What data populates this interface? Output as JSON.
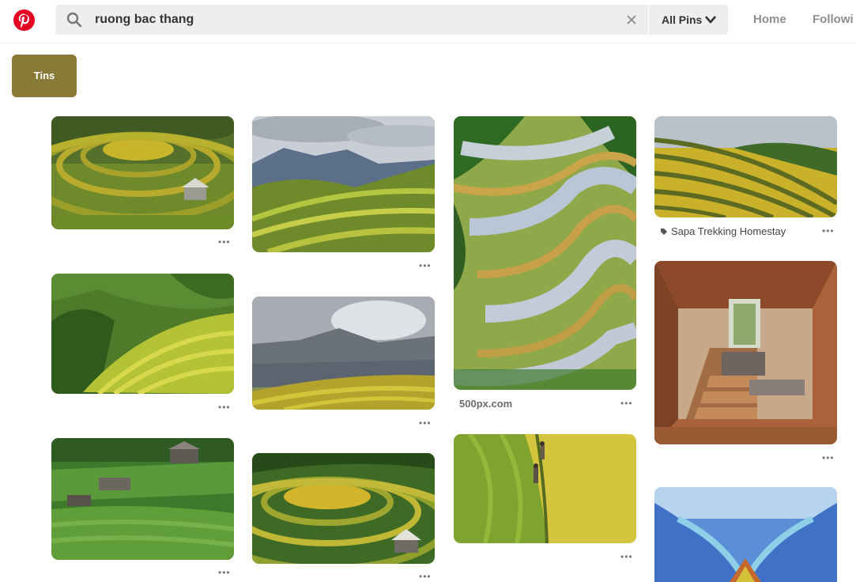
{
  "search": {
    "query": "ruong bac thang"
  },
  "filter": {
    "label": "All Pins"
  },
  "nav": {
    "home": "Home",
    "following": "Followi"
  },
  "chip": {
    "label": "Tins"
  },
  "pins": {
    "more": "•••",
    "source_500px": "500px.com",
    "source_sapa": "Sapa Trekking Homestay"
  },
  "colors": {
    "brand_red": "#e60023",
    "chip": "#8a7a38"
  },
  "icons": [
    "pinterest-logo-icon",
    "search-icon",
    "close-icon",
    "chevron-down-icon",
    "tag-icon"
  ]
}
